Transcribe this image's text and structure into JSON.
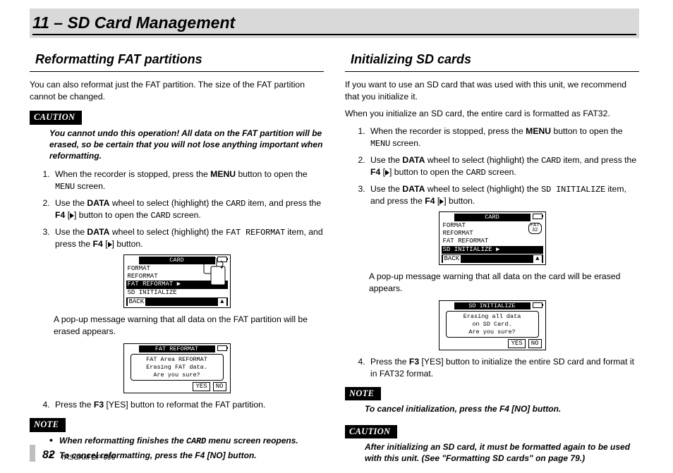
{
  "chapter": "11 – SD Card Management",
  "footer": {
    "page": "82",
    "product": "TASCAM  DP-006"
  },
  "left": {
    "title": "Reformatting FAT partitions",
    "intro": "You can also reformat just the FAT partition. The size of the FAT partition cannot be changed.",
    "caution_label": "CAUTION",
    "caution_body": "You cannot undo this operation! All data on the FAT partition will be erased, so be certain that you will not lose anything important when reformatting.",
    "steps": {
      "s1a": "When the recorder is stopped, press the ",
      "s1b": "MENU",
      "s1c": " button to open the ",
      "s1d": "MENU",
      "s1e": " screen.",
      "s2a": "Use the ",
      "s2b": "DATA",
      "s2c": " wheel to select (highlight) the ",
      "s2d": "CARD",
      "s2e": " item, and press the ",
      "s2f": "F4",
      "s2g": "] button to open the ",
      "s2h": "CARD",
      "s2i": " screen.",
      "s3a": "Use the ",
      "s3b": "DATA",
      "s3c": " wheel to select (highlight) the ",
      "s3d": "FAT REFORMAT",
      "s3e": " item, and press the ",
      "s3f": "F4",
      "s3g": "] button."
    },
    "lcd1": {
      "title": "CARD",
      "l1": "FORMAT",
      "l2": "REFORMAT",
      "l3": "FAT REFORMAT ▶",
      "l4": "SD INITIALIZE",
      "back": "BACK",
      "arrow": "▲"
    },
    "mid": "A pop-up message warning that all data on the FAT partition will be erased appears.",
    "lcd2": {
      "title": "FAT REFORMAT",
      "d1": "FAT Area REFORMAT",
      "d2": "Erasing FAT data.",
      "d3": "Are you sure?",
      "yes": "YES",
      "no": "NO"
    },
    "s4a": "Press the ",
    "s4b": "F3",
    "s4c": " [YES] button to reformat the FAT partition.",
    "note_label": "NOTE",
    "note1a": "When reformatting finishes the ",
    "note1b": "CARD",
    "note1c": " menu screen reopens.",
    "note2a": "To cancel reformatting, press the ",
    "note2b": "F4",
    "note2c": " [NO] button."
  },
  "right": {
    "title": "Initializing SD cards",
    "intro1": "If you want to use an SD card that was used with this unit, we recommend that you initialize it.",
    "intro2": "When you initialize an SD card, the entire card is formatted as FAT32.",
    "steps": {
      "s1a": "When the recorder is stopped, press the ",
      "s1b": "MENU",
      "s1c": " button to open the ",
      "s1d": "MENU",
      "s1e": " screen.",
      "s2a": "Use the ",
      "s2b": "DATA",
      "s2c": " wheel to select (highlight) the ",
      "s2d": "CARD",
      "s2e": " item, and press the ",
      "s2f": "F4",
      "s2g": "] button to open the ",
      "s2h": "CARD",
      "s2i": " screen.",
      "s3a": "Use the ",
      "s3b": "DATA",
      "s3c": " wheel to select (highlight) the ",
      "s3d": "SD INITIALIZE",
      "s3e": " item, and press the ",
      "s3f": "F4",
      "s3g": "] button."
    },
    "lcd1": {
      "title": "CARD",
      "l1": "FORMAT",
      "l2": "REFORMAT",
      "l3": "FAT REFORMAT",
      "l4": "SD INITIALIZE ▶",
      "fat32": "FAT\n32",
      "back": "BACK",
      "arrow": "▲"
    },
    "mid": "A pop-up message warning that all data on the card will be erased appears.",
    "lcd2": {
      "title": "SD INITIALIZE",
      "d1": "Erasing all data",
      "d2": "on SD Card.",
      "d3": "Are you sure?",
      "yes": "YES",
      "no": "NO"
    },
    "s4a": "Press the ",
    "s4b": "F3",
    "s4c": " [YES] button to initialize the entire SD card and format it in FAT32 format.",
    "note_label": "NOTE",
    "note1a": "To cancel initialization, press the ",
    "note1b": "F4",
    "note1c": " [NO] button.",
    "caution_label": "CAUTION",
    "caution_body": "After initializing an SD card, it must be formatted again to be used with this unit. (See \"Formatting SD cards\" on page 79.)"
  }
}
